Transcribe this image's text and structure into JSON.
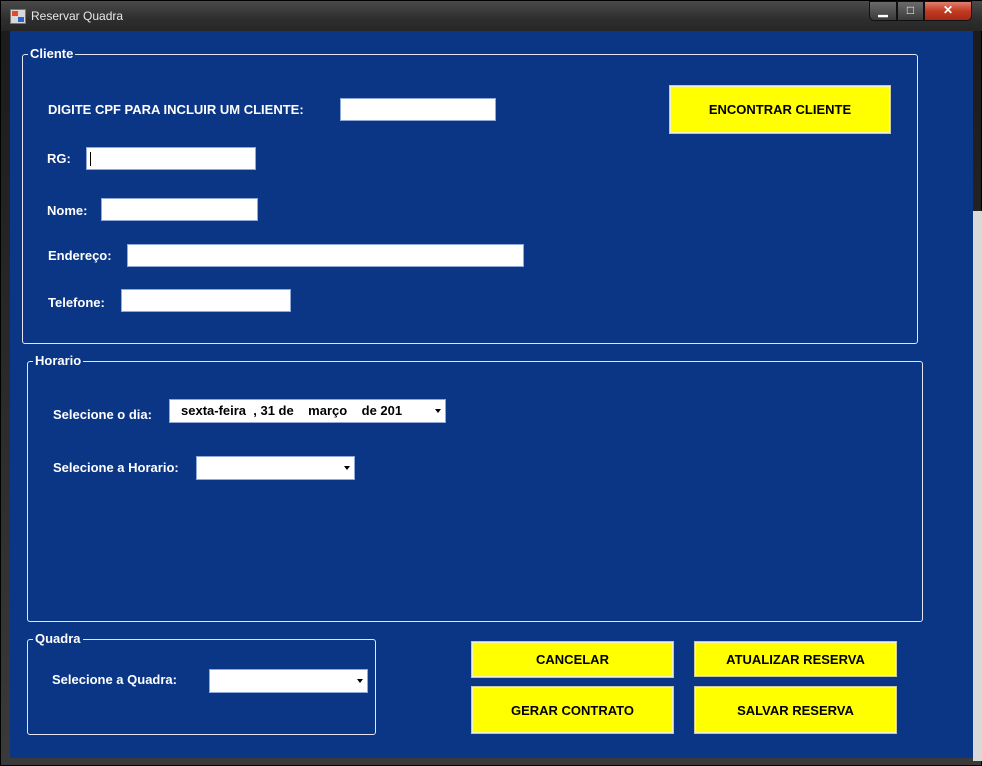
{
  "window": {
    "title": "Reservar Quadra",
    "controls": {
      "minimize": "▁",
      "maximize": "□",
      "close": "✕"
    }
  },
  "cliente": {
    "legend": "Cliente",
    "cpf_label": "DIGITE CPF PARA INCLUIR UM CLIENTE:",
    "cpf_value": "",
    "rg_label": "RG:",
    "rg_value": "",
    "nome_label": "Nome:",
    "nome_value": "",
    "endereco_label": "Endereço:",
    "endereco_value": "",
    "telefone_label": "Telefone:",
    "telefone_value": "",
    "find_button": "ENCONTRAR CLIENTE"
  },
  "horario": {
    "legend": "Horario",
    "dia_label": "Selecione o dia:",
    "date_display": "sexta-feira  , 31 de    março    de 201",
    "horario_label": "Selecione a Horario:",
    "horario_value": ""
  },
  "quadra": {
    "legend": "Quadra",
    "quadra_label": "Selecione a Quadra:",
    "quadra_value": ""
  },
  "buttons": {
    "cancelar": "CANCELAR",
    "atualizar": "ATUALIZAR RESERVA",
    "gerar_contrato": "GERAR CONTRATO",
    "salvar": "SALVAR RESERVA"
  },
  "colors": {
    "client_background": "#0b3585",
    "button_background": "#ffff00",
    "text": "#ffffff"
  }
}
